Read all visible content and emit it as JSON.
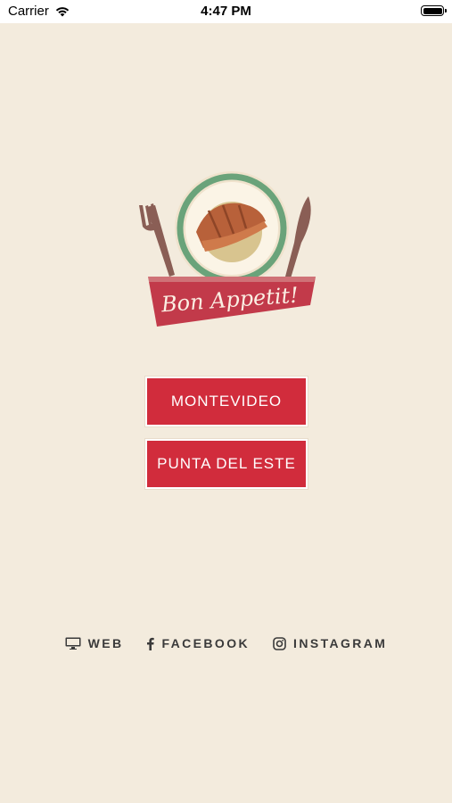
{
  "status_bar": {
    "carrier": "Carrier",
    "time": "4:47 PM"
  },
  "logo": {
    "text": "Bon Appetit!"
  },
  "buttons": {
    "montevideo": "MONTEVIDEO",
    "punta_del_este": "PUNTA DEL ESTE"
  },
  "links": {
    "web": "WEB",
    "facebook": "FACEBOOK",
    "instagram": "INSTAGRAM"
  },
  "colors": {
    "background": "#f3ebdd",
    "accent": "#d12c3c",
    "text": "#3a3a3a"
  }
}
